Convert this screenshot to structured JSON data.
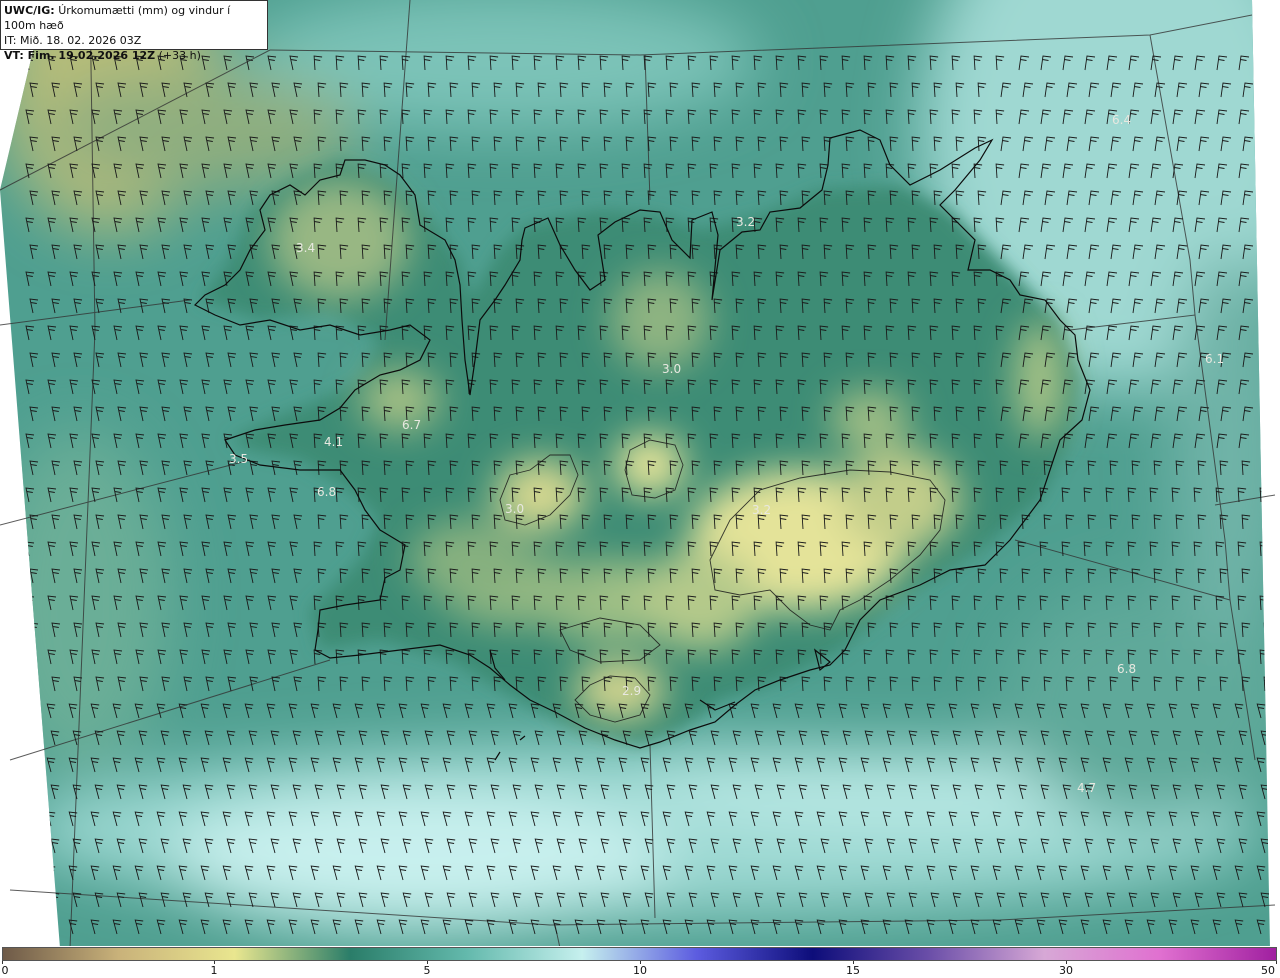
{
  "header": {
    "product_code": "UWC/IG:",
    "title": "Úrkomumætti (mm) og vindur í 100m hæð",
    "it_label": "IT:",
    "it_value": "Mið. 18. 02. 2026 03Z",
    "vt_label": "VT:",
    "vt_value": "Fim. 19.02.2026 12Z",
    "vt_offset": "(+33 h)"
  },
  "value_labels": [
    "6.4",
    "3.4",
    "3.2",
    "6.1",
    "3.0",
    "6.7",
    "4.1",
    "3.5",
    "6.8",
    "3.0",
    "3.2",
    "6.8",
    "2.9",
    "4.7"
  ],
  "colorbar": {
    "ticks": [
      "0",
      "1",
      "5",
      "10",
      "15",
      "30",
      "50"
    ],
    "colors": [
      "#6e5a48",
      "#c9b27a",
      "#e9e68f",
      "#2a7d69",
      "#63b9ac",
      "#c6f0ee",
      "#5c5ce0",
      "#0d0d7a",
      "#6a4ea8",
      "#d7a8d6",
      "#e070d0",
      "#a020a0"
    ]
  },
  "palette": {
    "sea_teal": "#4f9f90",
    "light_cyan": "#a6ded8",
    "dark_green": "#2e7a62",
    "yellow_land": "#d9da8c",
    "coast_line": "#111111"
  }
}
